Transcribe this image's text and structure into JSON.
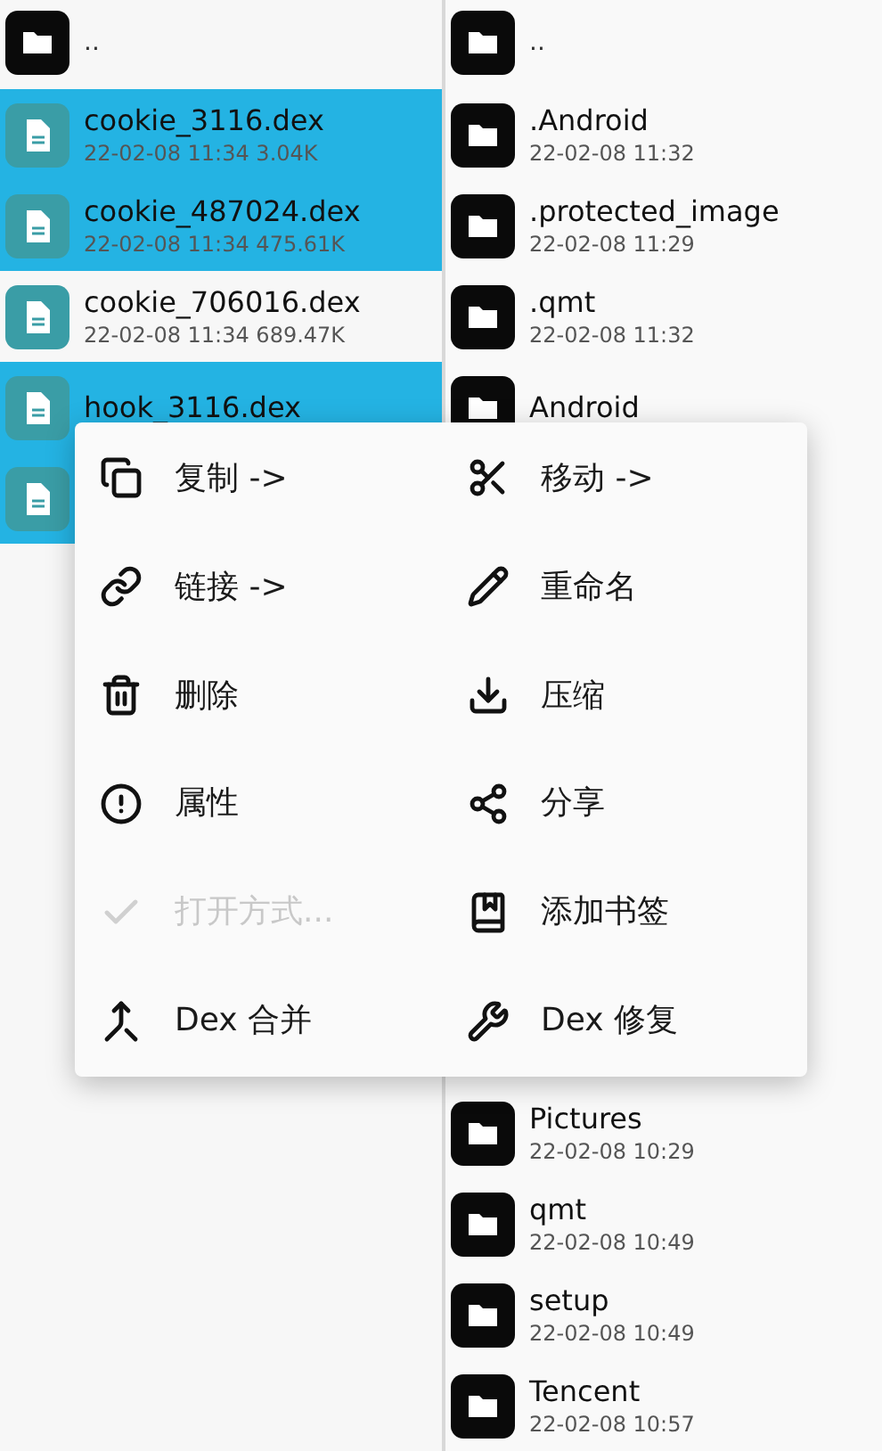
{
  "left_pane": {
    "parent": "..",
    "files": [
      {
        "name": "cookie_3116.dex",
        "info": "22-02-08 11:34  3.04K",
        "selected": true
      },
      {
        "name": "cookie_487024.dex",
        "info": "22-02-08 11:34  475.61K",
        "selected": true
      },
      {
        "name": "cookie_706016.dex",
        "info": "22-02-08 11:34  689.47K",
        "selected": false
      },
      {
        "name": "hook_3116.dex",
        "selected": true
      },
      {
        "selected": true
      }
    ]
  },
  "right_pane": {
    "parent": "..",
    "folders_top": [
      {
        "name": ".Android",
        "info": "22-02-08 11:32"
      },
      {
        "name": ".protected_image",
        "info": "22-02-08 11:29"
      },
      {
        "name": ".qmt",
        "info": "22-02-08 11:32"
      },
      {
        "name": "Android"
      }
    ],
    "folders_bottom": [
      {
        "name": "Pictures",
        "info": "22-02-08 10:29"
      },
      {
        "name": "qmt",
        "info": "22-02-08 10:49"
      },
      {
        "name": "setup",
        "info": "22-02-08 10:49"
      },
      {
        "name": "Tencent",
        "info": "22-02-08 10:57"
      }
    ]
  },
  "context_menu": {
    "items": [
      {
        "label": "复制 ->",
        "disabled": false
      },
      {
        "label": "移动 ->",
        "disabled": false
      },
      {
        "label": "链接 ->",
        "disabled": false
      },
      {
        "label": "重命名",
        "disabled": false
      },
      {
        "label": "删除",
        "disabled": false
      },
      {
        "label": "压缩",
        "disabled": false
      },
      {
        "label": "属性",
        "disabled": false
      },
      {
        "label": "分享",
        "disabled": false
      },
      {
        "label": "打开方式...",
        "disabled": true
      },
      {
        "label": "添加书签",
        "disabled": false
      },
      {
        "label": "Dex 合并",
        "disabled": false
      },
      {
        "label": "Dex 修复",
        "disabled": false
      }
    ]
  }
}
